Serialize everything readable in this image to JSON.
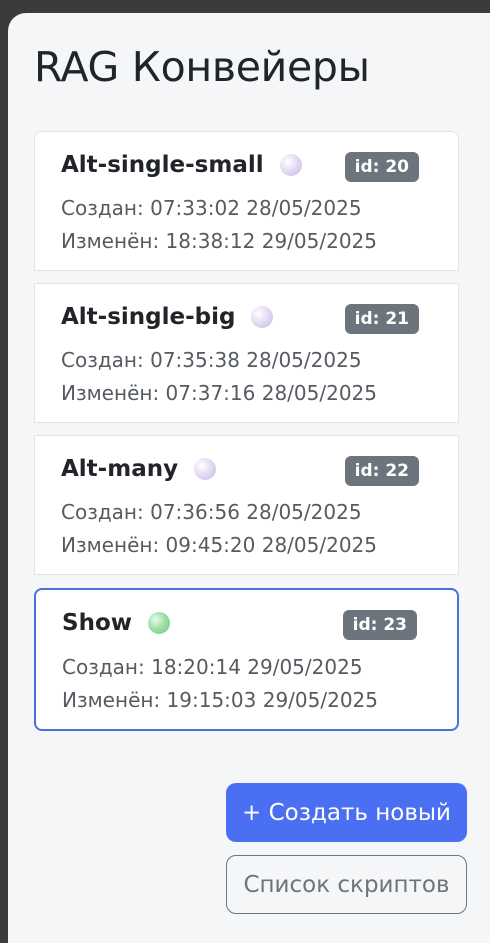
{
  "header": {
    "title": "RAG Конвейеры"
  },
  "pipelines": [
    {
      "name": "Alt-single-small",
      "status_color": "#d8cdee",
      "id_label": "id: 20",
      "created": "Создан: 07:33:02 28/05/2025",
      "modified": "Изменён: 18:38:12 29/05/2025",
      "selected": false
    },
    {
      "name": "Alt-single-big",
      "status_color": "#d8cdee",
      "id_label": "id: 21",
      "created": "Создан: 07:35:38 28/05/2025",
      "modified": "Изменён: 07:37:16 28/05/2025",
      "selected": false
    },
    {
      "name": "Alt-many",
      "status_color": "#d8cdee",
      "id_label": "id: 22",
      "created": "Создан: 07:36:56 28/05/2025",
      "modified": "Изменён: 09:45:20 28/05/2025",
      "selected": false
    },
    {
      "name": "Show",
      "status_color": "#9fe0a8",
      "id_label": "id: 23",
      "created": "Создан: 18:20:14 29/05/2025",
      "modified": "Изменён: 19:15:03 29/05/2025",
      "selected": true
    }
  ],
  "actions": {
    "create_label": "+ Создать новый",
    "scripts_label": "Список скриптов"
  },
  "colors": {
    "accent": "#4a6ff2",
    "selected_border": "#4a6fe3",
    "badge": "#6c757d"
  }
}
